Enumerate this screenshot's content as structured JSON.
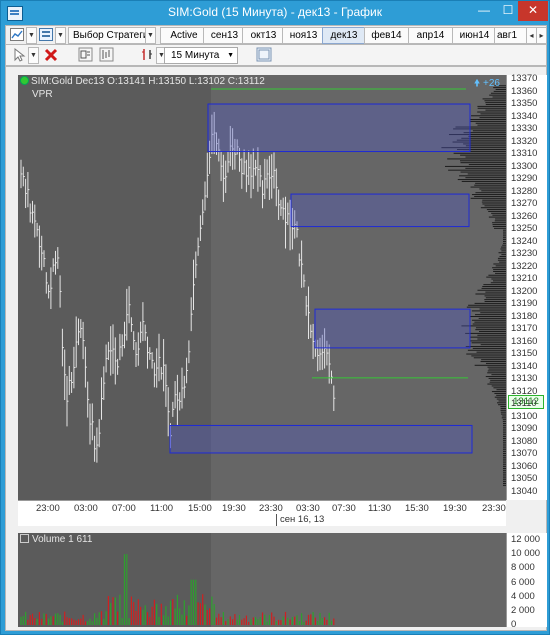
{
  "window": {
    "title": "SIM:Gold (15 Минута) - дек13 - График",
    "minimize": "—",
    "maximize": "☐",
    "close": "✕"
  },
  "toolbar": {
    "strategy_button": "Выбор Стратегии",
    "tabs": [
      "Active",
      "сен13",
      "окт13",
      "ноя13",
      "дек13",
      "фев14",
      "апр14",
      "июн14",
      "авг1"
    ],
    "active_tab": "дек13",
    "interval": "15 Минута"
  },
  "chart": {
    "instrument_info": "SIM:Gold Dec13 O:13141 H:13150 L:13102 C:13112",
    "indicator_label": "VPR",
    "plus_indicator": "+26",
    "last_price_label": "13112",
    "price_axis_labels": [
      "13370",
      "13360",
      "13350",
      "13340",
      "13330",
      "13320",
      "13310",
      "13300",
      "13290",
      "13280",
      "13270",
      "13260",
      "13250",
      "13240",
      "13230",
      "13220",
      "13210",
      "13200",
      "13190",
      "13180",
      "13170",
      "13160",
      "13150",
      "13140",
      "13130",
      "13120",
      "13110",
      "13100",
      "13090",
      "13080",
      "13070",
      "13060",
      "13050",
      "13040"
    ],
    "time_labels": [
      "23:00",
      "03:00",
      "07:00",
      "11:00",
      "15:00",
      "19:30",
      "23:30",
      "03:30",
      "07:30",
      "11:30",
      "15:30",
      "19:30",
      "23:30"
    ],
    "date_label": "сен 16, 13",
    "volume_label": "Volume 1 611",
    "volume_axis_labels": [
      "12 000",
      "10 000",
      "8 000",
      "6 000",
      "4 000",
      "2 000",
      "0"
    ],
    "colors": {
      "pane_bg": "#5b5b5b",
      "session_bg": "#666666",
      "bar": "#e5e5e5",
      "zone_fill": "rgba(80,90,200,0.35)",
      "zone_border": "#1e2ad6",
      "profile": "#1c1c1c",
      "line_green": "#37c837",
      "vol_up": "#2ea02e",
      "vol_down": "#d02020"
    }
  }
}
